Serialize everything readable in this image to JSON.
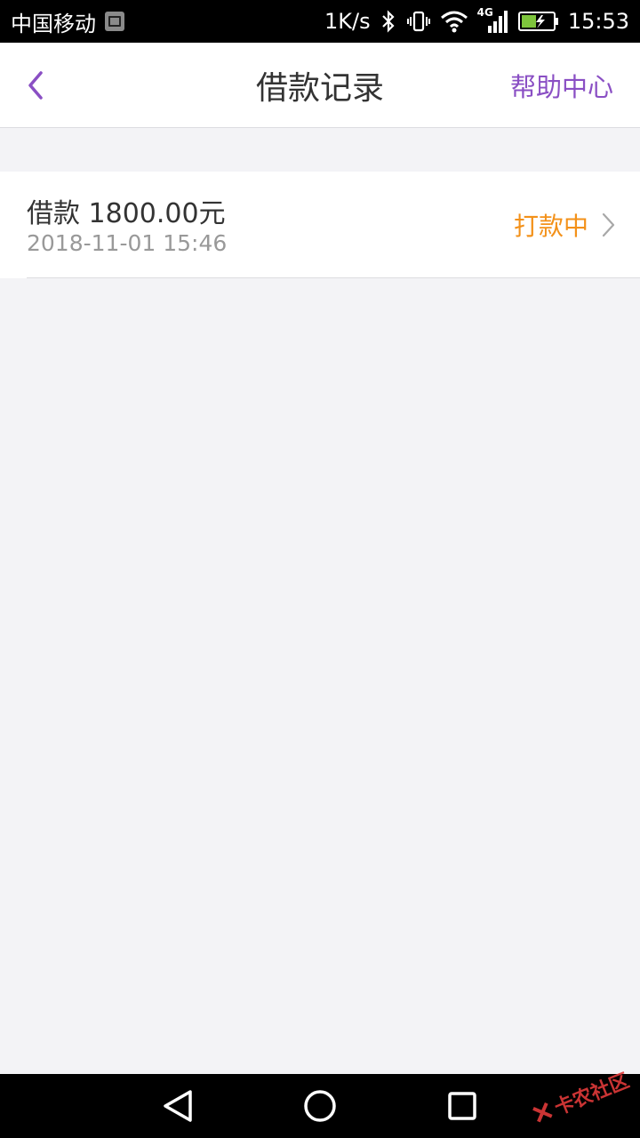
{
  "status_bar": {
    "carrier": "中国移动",
    "speed": "1K/s",
    "network_type": "4G",
    "time": "15:53"
  },
  "header": {
    "title": "借款记录",
    "help_label": "帮助中心"
  },
  "records": [
    {
      "title": "借款 1800.00元",
      "date": "2018-11-01 15:46",
      "status": "打款中"
    }
  ],
  "watermark": "卡农社区",
  "colors": {
    "accent": "#8a4fc4",
    "status": "#f39119",
    "background": "#f3f3f6"
  }
}
